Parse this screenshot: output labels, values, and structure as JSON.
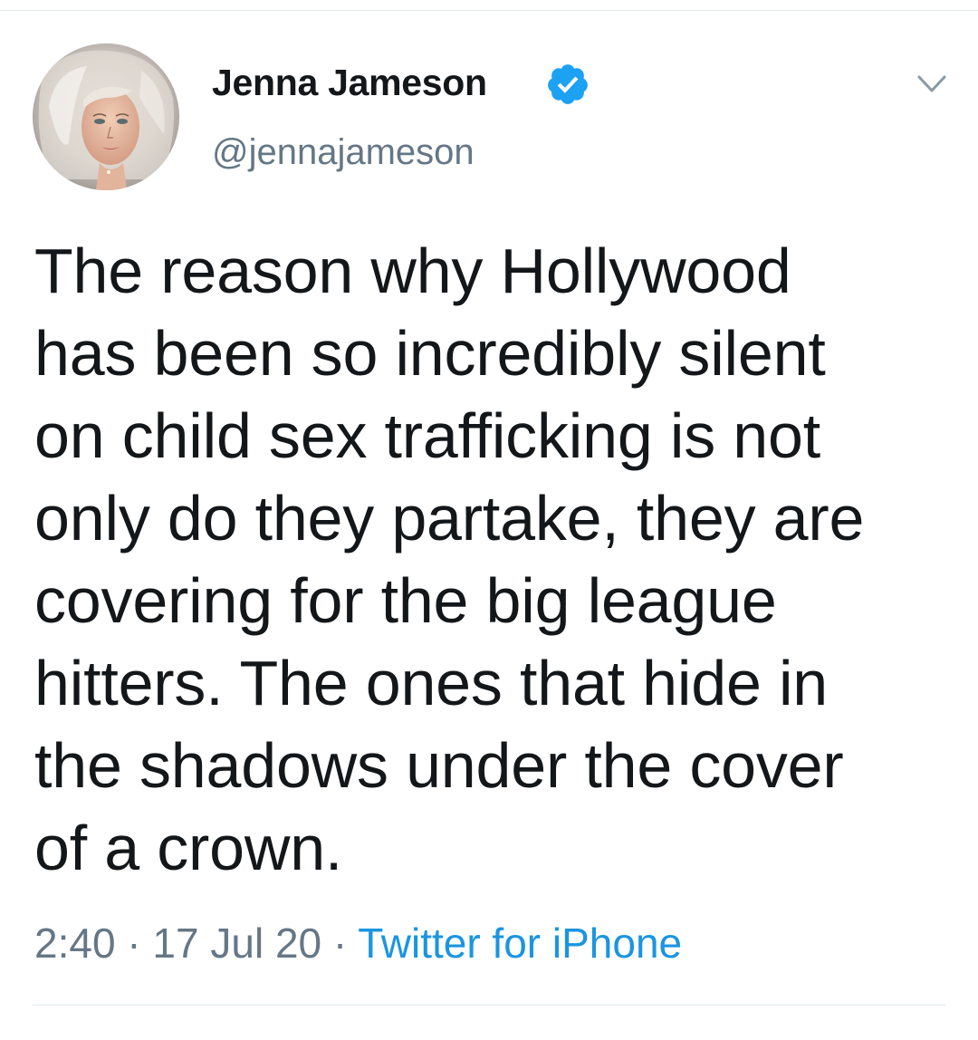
{
  "tweet": {
    "author": {
      "display_name": "Jenna Jameson",
      "handle": "@jennajameson",
      "verified": true,
      "avatar_icon": "profile-photo"
    },
    "text_lines": [
      "The reason why Hollywood",
      "has been so incredibly silent",
      "on child sex trafficking is not",
      "only do they partake, they are",
      "covering for the big league",
      "hitters. The ones that hide in",
      "the shadows under the cover",
      "of a crown."
    ],
    "time": "2:40",
    "separator": " · ",
    "date": "17 Jul 20",
    "source": "Twitter for iPhone"
  },
  "icons": {
    "verified": "verified-badge-icon",
    "menu": "chevron-down-icon"
  },
  "colors": {
    "text": "#14171a",
    "secondary_text": "#657786",
    "link": "#1b95e0",
    "verified_badge": "#1da1f2",
    "divider": "#e1e8ed",
    "background": "#ffffff"
  }
}
